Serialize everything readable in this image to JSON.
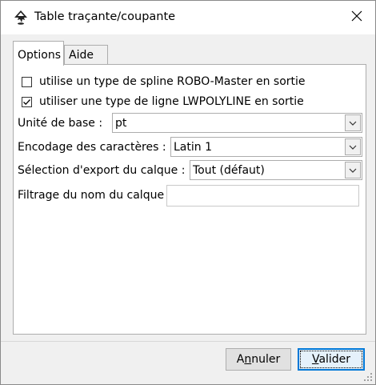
{
  "window": {
    "title": "Table traçante/coupante",
    "app_icon": "inkscape-icon",
    "close_icon": "close-icon"
  },
  "tabs": [
    {
      "label": "Options",
      "active": true
    },
    {
      "label": "Aide",
      "active": false
    }
  ],
  "options": {
    "checkbox_spline": {
      "label": "utilise un type de spline ROBO-Master en sortie",
      "checked": false
    },
    "checkbox_lwpolyline": {
      "label": "utiliser une type de ligne LWPOLYLINE en sortie",
      "checked": true
    },
    "base_unit": {
      "label": "Unité de base :",
      "value": "pt"
    },
    "encoding": {
      "label": "Encodage des caractères :",
      "value": "Latin 1"
    },
    "layer_export": {
      "label": "Sélection d'export du calque :",
      "value": "Tout (défaut)"
    },
    "layer_filter": {
      "label": "Filtrage du nom du calque :",
      "value": ""
    }
  },
  "buttons": {
    "cancel": {
      "label_pre": "A",
      "label_u": "n",
      "label_post": "nuler"
    },
    "ok": {
      "label_pre": "",
      "label_u": "V",
      "label_post": "alider"
    }
  }
}
